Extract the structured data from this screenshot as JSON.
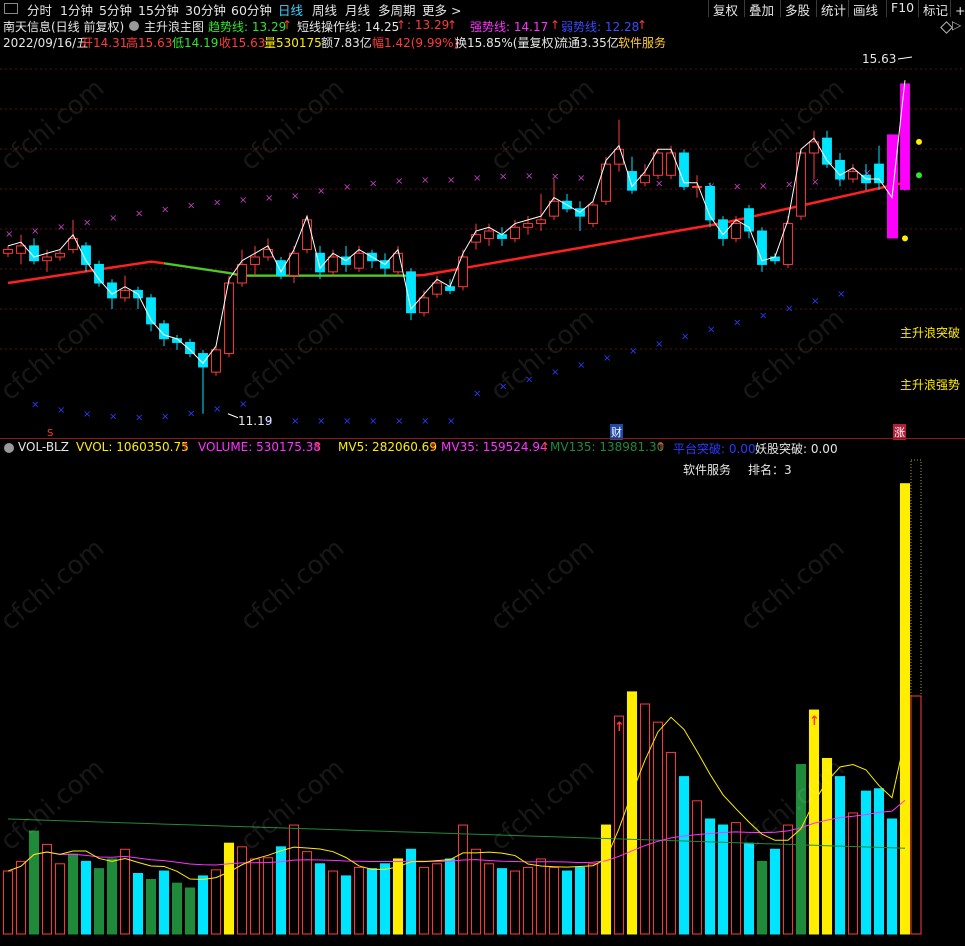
{
  "toolbar": {
    "periods": [
      "分时",
      "1分钟",
      "5分钟",
      "15分钟",
      "30分钟",
      "60分钟",
      "日线",
      "周线",
      "月线",
      "多周期",
      "更多"
    ],
    "active": "日线",
    "right_buttons": [
      "复权",
      "叠加",
      "多股",
      "统计",
      "画线",
      "F10",
      "标记",
      "+自"
    ]
  },
  "header": {
    "stock_name": "南天信息(日线 前复权)",
    "indicator_name": "主升浪主图",
    "trend_line": "趋势线: 13.29",
    "trend_arrow": "↑",
    "short_line": "短线操作线: 14.25",
    "short_arrow": "↑",
    "val3": ": 13.29",
    "val3_arrow": "↑",
    "strong_line": "强势线: 14.17",
    "strong_arrow": "↑",
    "weak_line": "弱势线: 12.28",
    "weak_arrow": "↑"
  },
  "quote": {
    "date": "2022/09/16/五",
    "open": "开14.31",
    "high": "高15.63",
    "low": "低14.19",
    "close": "收15.63",
    "volume": "量530175",
    "amount": "额7.83亿",
    "change": "幅1.42(9.99%)",
    "turnover": "换15.85%(量复权)",
    "float": "流通3.35亿",
    "industry": "软件服务"
  },
  "main_chart": {
    "high_label": "15.63",
    "low_label": "11.19",
    "marker_s": "S",
    "marker_cai": "财",
    "marker_zhang": "涨",
    "label_breakout": "主升浪突破",
    "label_strong": "主升浪强势"
  },
  "vol_header": {
    "name": "VOL-BLZ",
    "vvol": "VVOL: 1060350.75",
    "vvol_arrow": "↑",
    "volume": "VOLUME: 530175.38",
    "volume_arrow": "↑",
    "mv5": "MV5: 282060.69",
    "mv5_arrow": "↑",
    "mv35": "MV35: 159524.94",
    "mv35_arrow": "↑",
    "mv135": "MV135: 138981.30",
    "mv135_arrow": "↑",
    "platform": "平台突破: 0.00",
    "demon": "妖股突破: 0.00",
    "sector": "软件服务",
    "rank": "排名：3"
  },
  "colors": {
    "up": "#ff3b3b",
    "down": "#00e5ff",
    "limit": "#ff00ff",
    "ma": "#ff2020",
    "ma_flat": "#22e022",
    "band_up": "#c040c0",
    "band_down": "#2a3aff",
    "vol_yellow": "#ffee00",
    "vol_green": "#1e8a3a"
  },
  "chart_data": [
    {
      "type": "candlestick",
      "dates_visible": [
        "2022/09/16"
      ],
      "candles": [
        [
          13.35,
          13.4,
          13.3,
          13.45
        ],
        [
          13.35,
          13.45,
          13.2,
          13.6
        ],
        [
          13.45,
          13.25,
          13.2,
          13.55
        ],
        [
          13.25,
          13.3,
          13.1,
          13.4
        ],
        [
          13.3,
          13.35,
          13.25,
          13.4
        ],
        [
          13.4,
          13.55,
          13.35,
          13.8
        ],
        [
          13.45,
          13.2,
          13.1,
          13.5
        ],
        [
          13.2,
          12.95,
          12.9,
          13.25
        ],
        [
          12.95,
          12.75,
          12.6,
          13.0
        ],
        [
          12.75,
          12.85,
          12.7,
          13.05
        ],
        [
          12.85,
          12.75,
          12.6,
          12.9
        ],
        [
          12.75,
          12.4,
          12.3,
          12.8
        ],
        [
          12.4,
          12.2,
          12.1,
          12.45
        ],
        [
          12.2,
          12.15,
          12.05,
          12.25
        ],
        [
          12.15,
          12.0,
          11.95,
          12.2
        ],
        [
          12.0,
          11.82,
          11.19,
          12.05
        ],
        [
          11.75,
          12.05,
          11.7,
          12.1
        ],
        [
          12.0,
          12.95,
          11.95,
          13.05
        ],
        [
          12.95,
          13.2,
          12.9,
          13.4
        ],
        [
          13.2,
          13.3,
          13.05,
          13.45
        ],
        [
          13.3,
          13.4,
          13.25,
          13.55
        ],
        [
          13.25,
          13.05,
          13.0,
          13.3
        ],
        [
          13.05,
          13.35,
          12.95,
          13.45
        ],
        [
          13.4,
          13.8,
          13.35,
          13.85
        ],
        [
          13.35,
          13.1,
          13.0,
          13.45
        ],
        [
          13.1,
          13.3,
          13.05,
          13.4
        ],
        [
          13.3,
          13.2,
          13.1,
          13.45
        ],
        [
          13.15,
          13.35,
          13.1,
          13.45
        ],
        [
          13.35,
          13.25,
          13.15,
          13.4
        ],
        [
          13.25,
          13.15,
          13.05,
          13.35
        ],
        [
          13.1,
          13.35,
          13.05,
          13.45
        ],
        [
          13.1,
          12.55,
          12.45,
          13.15
        ],
        [
          12.55,
          12.75,
          12.5,
          12.85
        ],
        [
          12.8,
          12.95,
          12.75,
          13.05
        ],
        [
          12.9,
          12.85,
          12.8,
          13.0
        ],
        [
          12.9,
          13.3,
          12.85,
          13.4
        ],
        [
          13.5,
          13.6,
          13.4,
          13.75
        ],
        [
          13.55,
          13.65,
          13.45,
          13.75
        ],
        [
          13.6,
          13.55,
          13.45,
          13.7
        ],
        [
          13.55,
          13.7,
          13.5,
          13.8
        ],
        [
          13.7,
          13.75,
          13.6,
          13.85
        ],
        [
          13.75,
          13.8,
          13.65,
          14.15
        ],
        [
          13.85,
          14.05,
          13.8,
          14.35
        ],
        [
          14.05,
          13.95,
          13.9,
          14.15
        ],
        [
          13.95,
          13.85,
          13.65,
          14.05
        ],
        [
          13.75,
          14.0,
          13.7,
          14.05
        ],
        [
          14.05,
          14.55,
          14.0,
          14.65
        ],
        [
          14.55,
          14.75,
          14.45,
          15.15
        ],
        [
          14.45,
          14.2,
          14.15,
          14.65
        ],
        [
          14.3,
          14.4,
          14.25,
          14.55
        ],
        [
          14.4,
          14.7,
          14.35,
          14.75
        ],
        [
          14.4,
          14.7,
          14.35,
          14.8
        ],
        [
          14.7,
          14.25,
          14.2,
          14.75
        ],
        [
          14.25,
          14.25,
          14.1,
          14.4
        ],
        [
          14.25,
          13.8,
          13.7,
          14.3
        ],
        [
          13.8,
          13.55,
          13.45,
          13.85
        ],
        [
          13.55,
          13.75,
          13.5,
          13.85
        ],
        [
          13.95,
          13.65,
          13.55,
          14.0
        ],
        [
          13.65,
          13.2,
          13.1,
          13.7
        ],
        [
          13.3,
          13.25,
          13.2,
          13.35
        ],
        [
          13.2,
          13.75,
          13.15,
          13.85
        ],
        [
          13.85,
          14.7,
          13.8,
          14.75
        ],
        [
          14.7,
          14.85,
          14.35,
          15.0
        ],
        [
          14.9,
          14.55,
          14.5,
          15.0
        ],
        [
          14.6,
          14.35,
          14.25,
          14.7
        ],
        [
          14.35,
          14.45,
          14.3,
          14.55
        ],
        [
          14.4,
          14.3,
          14.2,
          14.55
        ],
        [
          14.55,
          14.3,
          14.2,
          14.8
        ],
        [
          14.5,
          14.05,
          13.85,
          14.55
        ],
        [
          14.21,
          15.63,
          14.19,
          15.63
        ]
      ]
    },
    {
      "type": "bar",
      "name": "VOLUME",
      "values": [
        52,
        60,
        85,
        74,
        58,
        66,
        60,
        54,
        62,
        70,
        50,
        45,
        52,
        42,
        38,
        48,
        53,
        75,
        72,
        62,
        63,
        72,
        90,
        68,
        58,
        52,
        48,
        55,
        54,
        58,
        62,
        70,
        55,
        58,
        62,
        90,
        70,
        58,
        54,
        52,
        55,
        62,
        55,
        52,
        55,
        58,
        90,
        180,
        200,
        190,
        175,
        150,
        130,
        110,
        95,
        90,
        92,
        75,
        60,
        70,
        90,
        140,
        185,
        145,
        130,
        100,
        118,
        120,
        95,
        372
      ]
    }
  ]
}
